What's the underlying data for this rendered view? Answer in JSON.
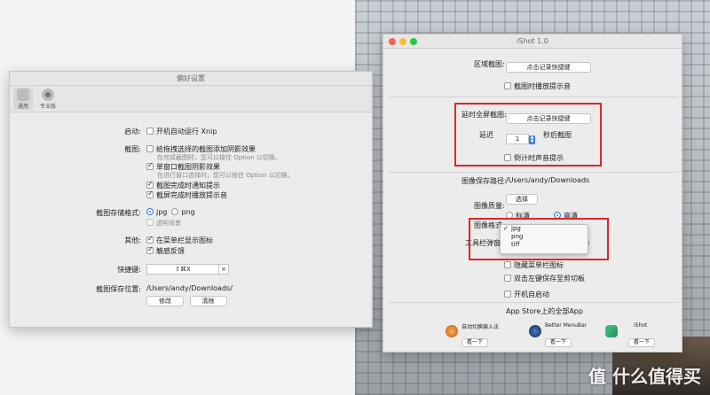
{
  "prefs": {
    "title": "偏好设置",
    "toolbar": {
      "general": "通用",
      "pro": "专业版"
    },
    "startup": {
      "label": "启动:",
      "option": "开机自动运行 Xnip"
    },
    "capture": {
      "label": "截图:",
      "drag_shadow": "给拖拽选择的截图添加阴影效果",
      "drag_hint": "在完成截图时，您可以按住 Option 以切换。",
      "window_shadow": "单窗口截图阴影效果",
      "window_hint": "在进行窗口选择时，您可以按住 Option 以切换。",
      "notify": "截图完成时通知提示",
      "sound": "截屏完成时播放提示音"
    },
    "format": {
      "label": "截图存储格式:",
      "jpg": "jpg",
      "png": "png",
      "transparent": "透明背景"
    },
    "other": {
      "label": "其他:",
      "menubar": "在菜单栏显示图标",
      "haptic": "触感反馈"
    },
    "shortcut": {
      "label": "快捷键:",
      "value": "⇧⌘X",
      "clear": "×"
    },
    "save": {
      "label": "截图保存位置:",
      "path": "/Users/andy/Downloads/",
      "modify": "修改",
      "clear": "清除"
    }
  },
  "ishot": {
    "title": "iShot 1.0",
    "region": {
      "label": "区域截图:",
      "button": "点击记录快捷键",
      "sound": "截图时播放提示音"
    },
    "delay": {
      "label": "延时全屏截图:",
      "button": "点击记录快捷键",
      "delay_label": "延迟",
      "delay_value": "1",
      "after": "秒后截图",
      "countdown": "倒计时声音提示"
    },
    "path": {
      "label": "图像保存路径:",
      "value": "/Users/andy/Downloads",
      "choose": "选择"
    },
    "quality": {
      "label": "图像质量:",
      "standard": "标清",
      "high": "高清"
    },
    "format": {
      "label": "图像格式:",
      "options": [
        "jpg",
        "png",
        "tiff"
      ],
      "selected": "jpg"
    },
    "toolbar_time": {
      "label": "工具栏弹窗响应时间",
      "suffix": "s"
    },
    "hide_menubar": "隐藏菜单栏图标",
    "dblclick": "双击左键保存至剪切板",
    "autostart": "开机自启动",
    "appstore": {
      "title": "App Store上的全部App",
      "apps": [
        {
          "name": "自动切换输入法",
          "button": "看一下"
        },
        {
          "name": "Better MenuBar",
          "button": "看一下"
        },
        {
          "name": "iShot",
          "button": "看一下"
        }
      ]
    }
  },
  "watermark": "值 什么值得买",
  "colors": {
    "accent": "#2f7ce9",
    "highlight": "#e0262b"
  }
}
